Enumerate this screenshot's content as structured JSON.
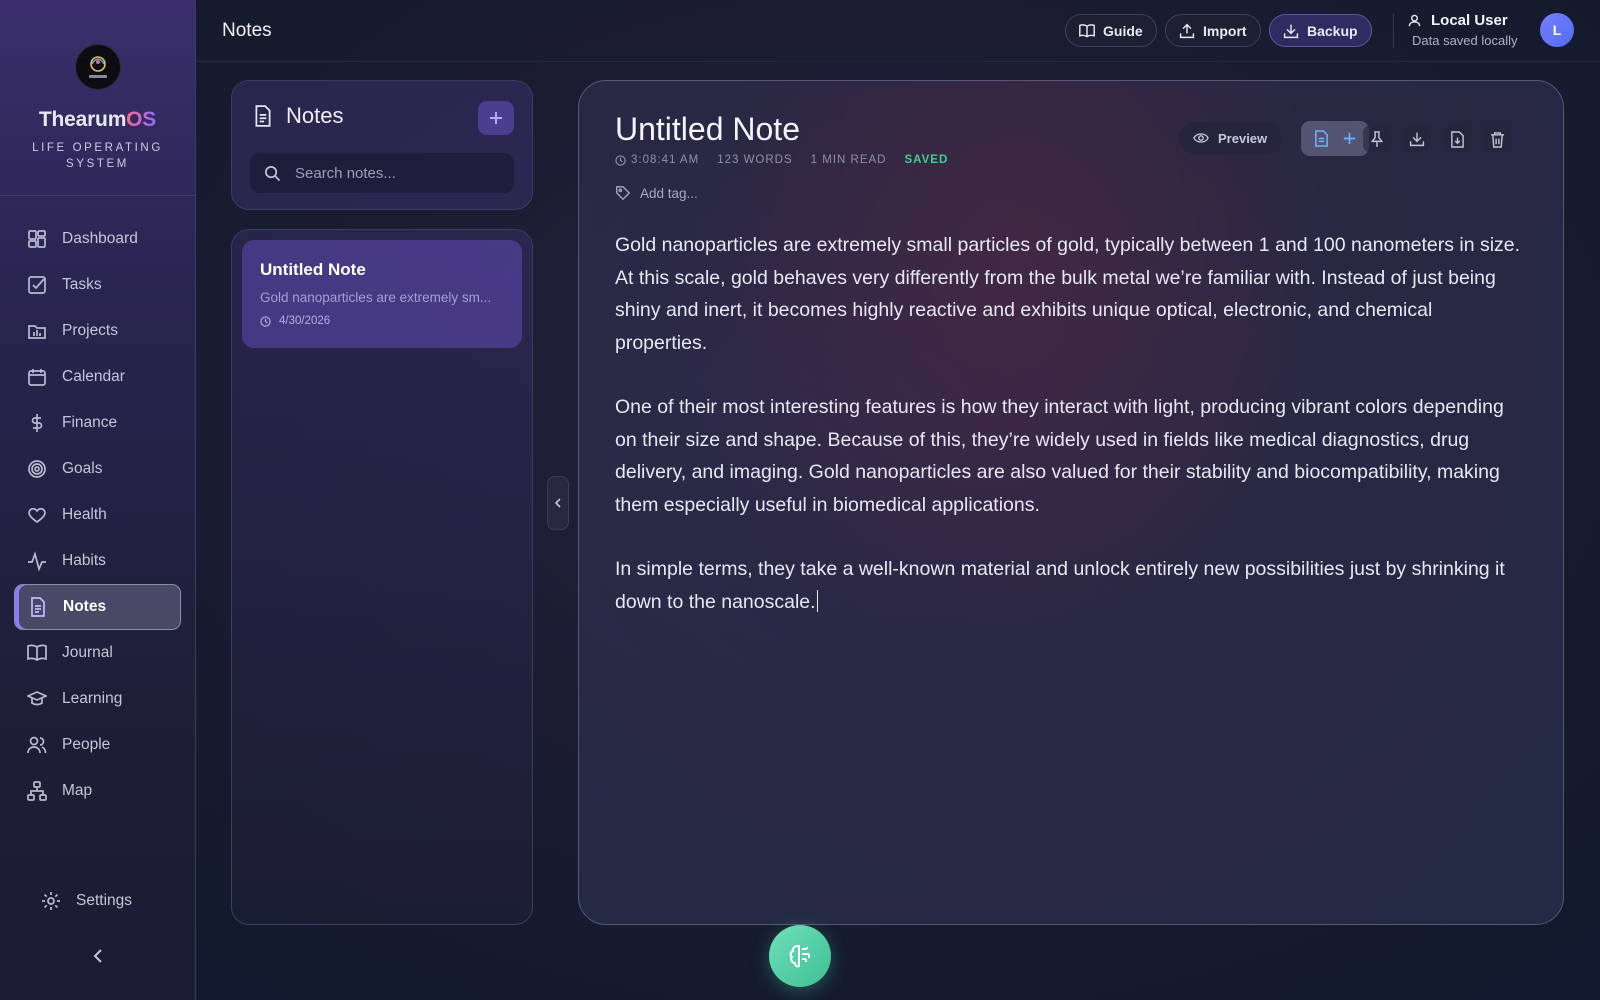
{
  "app": {
    "brand_prefix": "Thearum",
    "brand_suffix": "OS",
    "tagline": "LIFE OPERATING SYSTEM",
    "logo_text": "ThearumOS"
  },
  "sidebar": {
    "items": [
      {
        "label": "Dashboard",
        "icon": "dashboard-icon"
      },
      {
        "label": "Tasks",
        "icon": "tasks-icon"
      },
      {
        "label": "Projects",
        "icon": "projects-icon"
      },
      {
        "label": "Calendar",
        "icon": "calendar-icon"
      },
      {
        "label": "Finance",
        "icon": "dollar-icon"
      },
      {
        "label": "Goals",
        "icon": "target-icon"
      },
      {
        "label": "Health",
        "icon": "heart-icon"
      },
      {
        "label": "Habits",
        "icon": "activity-icon"
      },
      {
        "label": "Notes",
        "icon": "notes-icon",
        "active": true
      },
      {
        "label": "Journal",
        "icon": "book-icon"
      },
      {
        "label": "Learning",
        "icon": "graduation-cap-icon"
      },
      {
        "label": "People",
        "icon": "people-icon"
      },
      {
        "label": "Map",
        "icon": "sitemap-icon"
      }
    ],
    "settings_label": "Settings"
  },
  "topbar": {
    "title": "Notes",
    "guide_label": "Guide",
    "import_label": "Import",
    "backup_label": "Backup",
    "user_name": "Local User",
    "user_status": "Data saved locally",
    "avatar_initial": "L"
  },
  "notes_panel": {
    "title": "Notes",
    "search_placeholder": "Search notes...",
    "notes": [
      {
        "title": "Untitled Note",
        "preview": "Gold nanoparticles are extremely sm...",
        "date": "4/30/2026"
      }
    ]
  },
  "editor": {
    "title": "Untitled Note",
    "time": "3:08:41 AM",
    "words": "123 WORDS",
    "read_time": "1 MIN READ",
    "status": "SAVED",
    "tag_placeholder": "Add tag...",
    "preview_label": "Preview",
    "paragraphs": [
      "Gold nanoparticles are extremely small particles of gold, typically between 1 and 100 nanometers in size. At this scale, gold behaves very differently from the bulk metal we’re familiar with. Instead of just being shiny and inert, it becomes highly reactive and exhibits unique optical, electronic, and chemical properties.",
      "One of their most interesting features is how they interact with light, producing vibrant colors depending on their size and shape. Because of this, they’re widely used in fields like medical diagnostics, drug delivery, and imaging. Gold nanoparticles are also valued for their stability and biocompatibility, making them especially useful in biomedical applications.",
      "In simple terms, they take a well-known material and unlock entirely new possibilities just by shrinking it down to the nanoscale."
    ]
  },
  "colors": {
    "accent": "#8b7bff",
    "saved": "#3fcf8e",
    "fab": "#4fcfa5"
  }
}
